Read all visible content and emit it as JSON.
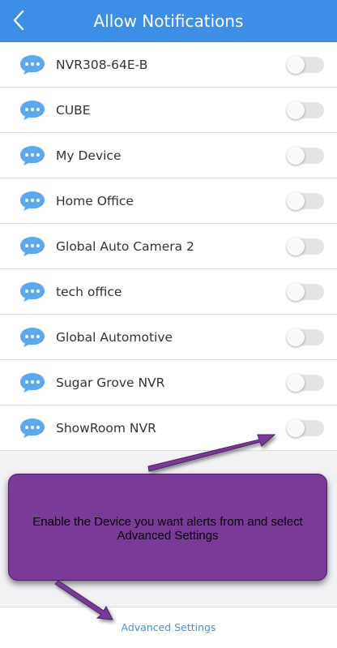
{
  "header": {
    "title": "Allow Notifications",
    "back_icon": "chevron-left-icon"
  },
  "devices": [
    {
      "name": "NVR308-64E-B",
      "enabled": false
    },
    {
      "name": "CUBE",
      "enabled": false
    },
    {
      "name": "My Device",
      "enabled": false
    },
    {
      "name": "Home Office",
      "enabled": false
    },
    {
      "name": "Global Auto Camera 2",
      "enabled": false
    },
    {
      "name": "tech office",
      "enabled": false
    },
    {
      "name": "Global Automotive",
      "enabled": false
    },
    {
      "name": "Sugar Grove NVR",
      "enabled": false
    },
    {
      "name": "ShowRoom NVR",
      "enabled": false
    }
  ],
  "callout": {
    "text": "Enable the Device you want alerts from and select Advanced Settings"
  },
  "footer": {
    "advanced_label": "Advanced Settings"
  },
  "colors": {
    "header_bg": "#3c8ee6",
    "chat_icon": "#5aa8ee",
    "callout_bg": "#7a3a98",
    "link": "#4a90d0"
  }
}
